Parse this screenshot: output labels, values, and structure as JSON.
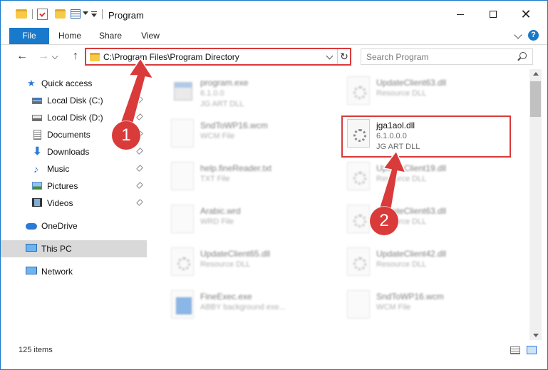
{
  "window": {
    "title": "Program",
    "controls": {
      "minimize": "—",
      "maximize": "☐",
      "close": "✕"
    }
  },
  "ribbon": {
    "tabs": [
      "File",
      "Home",
      "Share",
      "View"
    ],
    "help": "?"
  },
  "navigation": {
    "back": "←",
    "forward": "→",
    "up": "↑",
    "address": "C:\\Program Files\\Program Directory",
    "refresh": "↻",
    "search_placeholder": "Search Program"
  },
  "sidebar": {
    "items": [
      {
        "label": "Quick access",
        "icon": "star-icon",
        "pinned": false
      },
      {
        "label": "Local Disk (C:)",
        "icon": "drive-c-icon",
        "pinned": true
      },
      {
        "label": "Local Disk (D:)",
        "icon": "drive-d-icon",
        "pinned": true
      },
      {
        "label": "Documents",
        "icon": "documents-icon",
        "pinned": true
      },
      {
        "label": "Downloads",
        "icon": "downloads-icon",
        "pinned": true
      },
      {
        "label": "Music",
        "icon": "music-icon",
        "pinned": true
      },
      {
        "label": "Pictures",
        "icon": "pictures-icon",
        "pinned": true
      },
      {
        "label": "Videos",
        "icon": "videos-icon",
        "pinned": true
      },
      {
        "label": "OneDrive",
        "icon": "onedrive-icon",
        "pinned": false
      },
      {
        "label": "This PC",
        "icon": "this-pc-icon",
        "pinned": false,
        "selected": true
      },
      {
        "label": "Network",
        "icon": "network-icon",
        "pinned": false
      }
    ]
  },
  "files": {
    "left": [
      {
        "name": "program.exe",
        "line2": "6.1.0.0",
        "line3": "JG ART DLL",
        "icon": "exe-icon"
      },
      {
        "name": "SndToWP16.wcm",
        "line2": "WCM File",
        "line3": "",
        "icon": "file-icon"
      },
      {
        "name": "help.fineReader.txt",
        "line2": "TXT File",
        "line3": "",
        "icon": "file-icon"
      },
      {
        "name": "Arabic.wrd",
        "line2": "WRD File",
        "line3": "",
        "icon": "file-icon"
      },
      {
        "name": "UpdateClient65.dll",
        "line2": "Resource DLL",
        "line3": "",
        "icon": "dll-icon"
      },
      {
        "name": "FineExec.exe",
        "line2": "ABBY background exe...",
        "line3": "",
        "icon": "app-icon"
      }
    ],
    "right": [
      {
        "name": "UpdateClient63.dll",
        "line2": "Resource DLL",
        "line3": "",
        "icon": "dll-icon"
      },
      {
        "name": "jga1aol.dll",
        "line2": "6.1.0.0.0",
        "line3": "JG ART DLL",
        "icon": "dll-icon",
        "highlighted": true
      },
      {
        "name": "UpdateClient19.dll",
        "line2": "Resource DLL",
        "line3": "",
        "icon": "dll-icon"
      },
      {
        "name": "UpdateClient63.dll",
        "line2": "Resource DLL",
        "line3": "",
        "icon": "dll-icon"
      },
      {
        "name": "UpdateClient42.dll",
        "line2": "Resource DLL",
        "line3": "",
        "icon": "dll-icon"
      },
      {
        "name": "SndToWP16.wcm",
        "line2": "WCM File",
        "line3": "",
        "icon": "file-icon"
      }
    ]
  },
  "status": {
    "items": "125 items"
  },
  "annotations": {
    "step1": "1",
    "step2": "2",
    "color": "#d93a3a"
  },
  "colors": {
    "accent": "#1979ca",
    "highlight": "#d93a3a"
  }
}
